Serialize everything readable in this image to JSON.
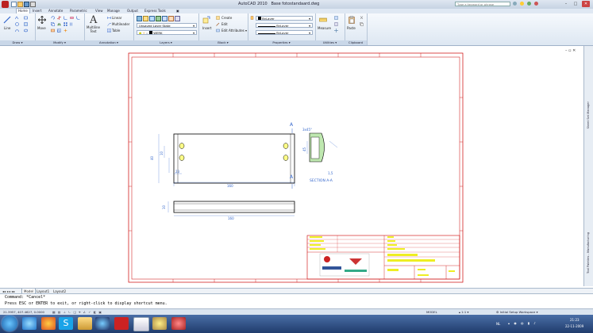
{
  "titlebar": {
    "app_title": "AutoCAD 2010",
    "file_name": "Base fotostandaard.dwg",
    "search_placeholder": "Type a keyword or phrase"
  },
  "tabs": [
    "Home",
    "Insert",
    "Annotate",
    "Parametric",
    "View",
    "Manage",
    "Output",
    "Express Tools"
  ],
  "ribbon": {
    "draw": {
      "title": "Draw",
      "line": "Line"
    },
    "modify": {
      "title": "Modify",
      "move": "Move"
    },
    "annotation": {
      "title": "Annotation",
      "multiline_text": "Multiline",
      "multiline_text2": "Text",
      "linear": "Linear",
      "multileader": "Multileader",
      "table": "Table"
    },
    "layers": {
      "title": "Layers",
      "layer_state": "Unsaved Layer State",
      "current_layer": "WERK"
    },
    "block": {
      "title": "Block",
      "insert": "Insert",
      "create": "Create",
      "edit": "Edit",
      "edit_attributes": "Edit Attributes"
    },
    "properties": {
      "title": "Properties",
      "color": "ByLayer",
      "linetype": "ByLayer",
      "lineweight": "ByLayer"
    },
    "utilities": {
      "title": "Utilities",
      "measure": "Measure"
    },
    "clipboard": {
      "title": "Clipboard",
      "paste": "Paste"
    }
  },
  "right_palettes": {
    "sheet_set": "Sheet Set Manager",
    "tool_palettes": "Tool Palettes - Manufacturing"
  },
  "drawing": {
    "dims": {
      "total_length": "160",
      "left_offset": "23",
      "height_total": "40",
      "small_gap": "10",
      "bottom_length": "160",
      "bottom_height": "10",
      "section_top": "3x45°",
      "section_width": "45",
      "section_bottom": "1,5"
    },
    "section_label": "SECTION A-A",
    "section_marker": "A"
  },
  "layout_tabs": [
    "Model",
    "Layout1",
    "Layout2"
  ],
  "command": {
    "line1": "Command: *Cancel*",
    "line2": "Press ESC or ENTER to exit, or right-click to display shortcut menu."
  },
  "status": {
    "coords": "21.3957, 407.4627, 0.0000",
    "model": "MODEL",
    "scale": "1:1",
    "workspace": "Initial Setup Workspace"
  },
  "taskbar": {
    "time": "21:23",
    "date": "22-11-2009",
    "lang": "NL"
  }
}
